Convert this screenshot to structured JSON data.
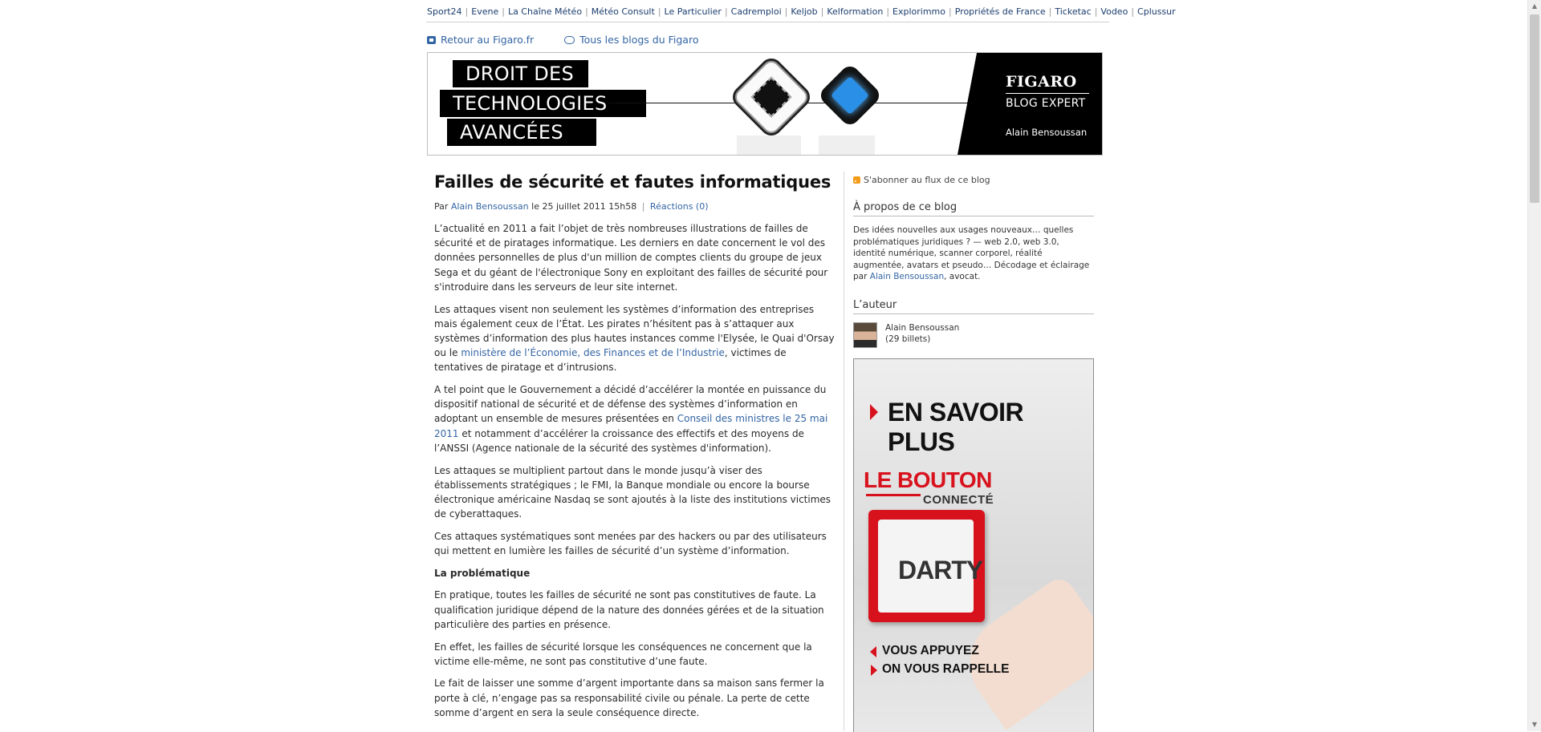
{
  "network_bar": [
    "Sport24",
    "Evene",
    "La Chaîne Météo",
    "Météo Consult",
    "Le Particulier",
    "Cadremploi",
    "Keljob",
    "Kelformation",
    "Explorimmo",
    "Propriétés de France",
    "Ticketac",
    "Vodeo",
    "Cplussur"
  ],
  "nav": {
    "back_link": "Retour au Figaro.fr",
    "blogs_link": "Tous les blogs du Figaro"
  },
  "banner": {
    "title_line1": "DROIT DES",
    "title_line2": "TECHNOLOGIES",
    "title_line3": "AVANCÉES",
    "brand": "FIGARO",
    "brand_sub": "BLOG EXPERT",
    "author": "Alain Bensoussan"
  },
  "article": {
    "title": "Failles de sécurité et fautes informatiques",
    "meta_by": "Par",
    "meta_author": "Alain Bensoussan",
    "meta_date": "le 25 juillet 2011 15h58",
    "meta_sep": "|",
    "meta_reactions": "Réactions (0)",
    "p1": "L’actualité en 2011 a fait l’objet de très nombreuses illustrations de failles de sécurité et de piratages informatique. Les derniers en date concernent le vol des données personnelles de plus d'un million de comptes clients du groupe de jeux Sega et du géant de l'électronique Sony en exploitant des failles de sécurité pour s'introduire dans les serveurs de leur site internet.",
    "p2_a": "Les attaques visent non seulement les systèmes d’information des entreprises mais également ceux de l’État. Les pirates n’hésitent pas à s’attaquer aux systèmes d’information des plus hautes instances comme l'Elysée, le Quai d'Orsay ou le",
    "p2_link": "ministère de l’Économie, des Finances et de l’Industrie",
    "p2_b": ", victimes de tentatives de piratage et d’intrusions.",
    "p3_a": "A tel point que le Gouvernement a décidé d’accélérer la montée en puissance du dispositif national de sécurité et de défense des systèmes d’information en adoptant un ensemble de mesures présentées en",
    "p3_link": "Conseil des ministres le 25 mai 2011",
    "p3_b": "et notamment d’accélérer la croissance des effectifs et des moyens de l’ANSSI (Agence nationale de la sécurité des systèmes d'information).",
    "p4": "Les attaques se multiplient partout dans le monde jusqu’à viser des établissements stratégiques ; le FMI, la Banque mondiale ou encore la bourse électronique américaine Nasdaq se sont  ajoutés à la liste des institutions victimes de cyberattaques.",
    "p5": "Ces attaques systématiques sont menées par des hackers ou par des utilisateurs qui mettent en lumière les failles de sécurité d’un système d’information.",
    "subhead": "La problématique",
    "p6": "En pratique, toutes les failles de sécurité ne sont pas constitutives de faute. La qualification juridique dépend de la nature des données gérées et de la situation particulière des parties en présence.",
    "p7": "En effet, les failles de sécurité lorsque les conséquences ne concernent que la victime elle-même, ne sont pas constitutive d’une faute.",
    "p8": "Le fait de laisser une somme d’argent importante dans sa maison sans fermer la porte à clé, n’engage pas sa responsabilité civile ou pénale. La perte de cette somme d’argent en sera la seule conséquence directe."
  },
  "sidebar": {
    "rss": "S'abonner au flux de ce blog",
    "about_heading": "À propos de ce blog",
    "about_text": "Des idées nouvelles aux usages nouveaux… quelles problématiques juridiques ? — web 2.0, web 3.0, identité numérique, scanner corporel, réalité augmentée, avatars et pseudo… Décodage et éclairage par",
    "about_link": "Alain Bensoussan",
    "about_end": ", avocat.",
    "author_heading": "L’auteur",
    "author_name": "Alain Bensoussan",
    "author_count": "(29 billets)"
  },
  "ad": {
    "headline": "EN SAVOIR PLUS",
    "le_bouton": "LE BOUTON",
    "connecte": "CONNECTÉ",
    "brand": "DARTY",
    "line1": "VOUS APPUYEZ",
    "line2": "ON VOUS RAPPELLE"
  },
  "colors": {
    "link": "#3465a4",
    "ad_red": "#d8121d",
    "banner_black": "#000000"
  }
}
